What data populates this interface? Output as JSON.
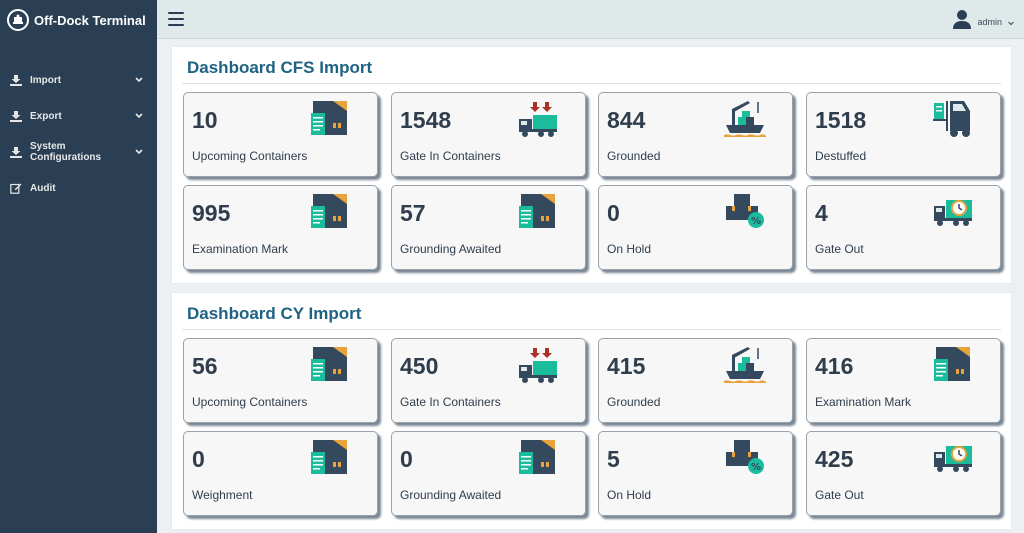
{
  "app": {
    "title": "Off-Dock Terminal"
  },
  "sidebar": {
    "items": [
      {
        "label": "Import",
        "icon": "download-icon",
        "has_submenu": true
      },
      {
        "label": "Export",
        "icon": "download-icon",
        "has_submenu": true
      },
      {
        "label": "System Configurations",
        "icon": "download-icon",
        "has_submenu": true
      },
      {
        "label": "Audit",
        "icon": "edit-icon",
        "has_submenu": false
      }
    ]
  },
  "topbar": {
    "user": "admin"
  },
  "colors": {
    "sidebar": "#2a3f54",
    "topbar": "#dfe9e9",
    "title": "#1f6384",
    "accent_teal": "#1abc9c",
    "icon_dark": "#34495e",
    "icon_orange": "#e8a33d",
    "icon_red": "#a93226"
  },
  "sections": [
    {
      "title": "Dashboard CFS Import",
      "tiles": [
        {
          "value": "10",
          "label": "Upcoming Containers",
          "icon": "document-box-icon"
        },
        {
          "value": "1548",
          "label": "Gate In Containers",
          "icon": "truck-arrow-icon"
        },
        {
          "value": "844",
          "label": "Grounded",
          "icon": "ship-crane-icon"
        },
        {
          "value": "1518",
          "label": "Destuffed",
          "icon": "forklift-icon"
        },
        {
          "value": "995",
          "label": "Examination Mark",
          "icon": "document-box-icon"
        },
        {
          "value": "57",
          "label": "Grounding Awaited",
          "icon": "document-box-icon"
        },
        {
          "value": "0",
          "label": "On Hold",
          "icon": "boxes-percent-icon"
        },
        {
          "value": "4",
          "label": "Gate Out",
          "icon": "truck-clock-icon"
        }
      ]
    },
    {
      "title": "Dashboard CY Import",
      "tiles": [
        {
          "value": "56",
          "label": "Upcoming Containers",
          "icon": "document-box-icon"
        },
        {
          "value": "450",
          "label": "Gate In Containers",
          "icon": "truck-arrow-icon"
        },
        {
          "value": "415",
          "label": "Grounded",
          "icon": "ship-crane-icon"
        },
        {
          "value": "416",
          "label": "Examination Mark",
          "icon": "document-box-icon"
        },
        {
          "value": "0",
          "label": "Weighment",
          "icon": "document-box-icon"
        },
        {
          "value": "0",
          "label": "Grounding Awaited",
          "icon": "document-box-icon"
        },
        {
          "value": "5",
          "label": "On Hold",
          "icon": "boxes-percent-icon"
        },
        {
          "value": "425",
          "label": "Gate Out",
          "icon": "truck-clock-icon"
        }
      ]
    }
  ]
}
